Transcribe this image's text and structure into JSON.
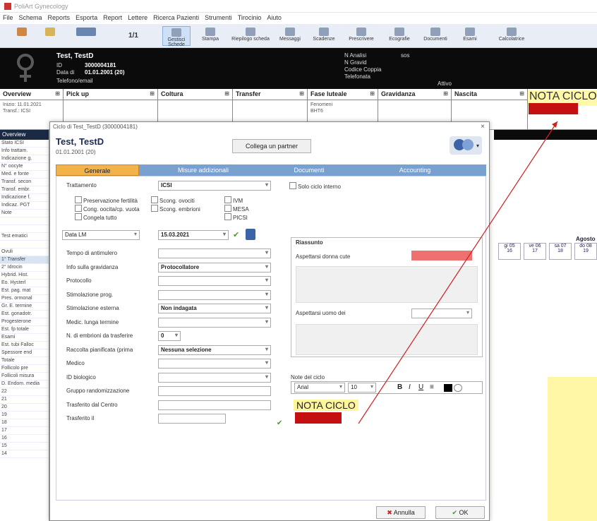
{
  "window": {
    "title": "PoliArt Gynecology",
    "app_icon": "app-logo-icon"
  },
  "menu": [
    "File",
    "Schema",
    "Reports",
    "Esporta",
    "Report",
    "Lettere",
    "Ricerca Pazienti",
    "Strumenti",
    "Tirocinio",
    "Aiuto"
  ],
  "toolbar": {
    "page_indicator": "1/1",
    "items": [
      {
        "label": "Gestisci Schede",
        "icon": "folder-icon"
      },
      {
        "label": "Stampa",
        "icon": "printer-icon"
      },
      {
        "label": "Riepilogo scheda",
        "icon": "summary-icon"
      },
      {
        "label": "Messaggi",
        "icon": "message-icon"
      },
      {
        "label": "Scadenze",
        "icon": "calendar-icon"
      },
      {
        "label": "Prescrivere",
        "icon": "prescription-icon"
      },
      {
        "label": "Ecografie",
        "icon": "ultrasound-icon"
      },
      {
        "label": "Documenti",
        "icon": "document-icon"
      },
      {
        "label": "Esami",
        "icon": "exam-icon"
      },
      {
        "label": "Calcolatrice",
        "icon": "calculator-icon"
      }
    ]
  },
  "patient": {
    "name": "Test, TestD",
    "id_label": "ID",
    "id_value": "3000004181",
    "dob_label": "Data di",
    "dob_value": "01.01.2001 (20)",
    "extra_label": "Telefono/email",
    "right_labels": [
      "N Analisi",
      "N Gravid",
      "Codice Coppia",
      "Telefonata"
    ],
    "right_value": "sos",
    "status": "Attivo"
  },
  "columns": [
    {
      "title": "Overview",
      "content": [
        "Inizio: 11.01.2021",
        "Transf.: ICSI"
      ]
    },
    {
      "title": "Pick up",
      "content": []
    },
    {
      "title": "Coltura",
      "content": []
    },
    {
      "title": "Transfer",
      "content": []
    },
    {
      "title": "Fase luteale",
      "content": [
        "Fenomeni",
        "BHT6"
      ]
    },
    {
      "title": "Gravidanza",
      "content": []
    },
    {
      "title": "Nascita",
      "content": []
    }
  ],
  "nota_header": "NOTA CICLO",
  "left_panel": {
    "tab": "Overview",
    "rows": [
      "Stato ICSI",
      "Info trattam.",
      "Indicazione g.",
      "N° oocyte",
      "Med. e fonte",
      "Transf. secon",
      "Transf. embr.",
      "Indicazione f.",
      "Indicaz. PGT",
      "Note",
      "",
      "",
      "Test ematici",
      "",
      "Ovuli",
      "1° Transfer",
      "2° Idrocin",
      "Hybrid. Hist.",
      "Eo. Hysterl",
      "Est. pag. mat",
      "Pres. ormonal",
      "Gr. E. termine",
      "Est. gonadotr.",
      "Progesterone",
      "Est. fp totale",
      "Esami",
      "Est. tubi Falloc",
      "Spessore end",
      "Totale",
      "Follicolo pre",
      "Follicoli misura",
      "D. Endom. media",
      "22",
      "21",
      "20",
      "19",
      "18",
      "17",
      "16",
      "15",
      "14"
    ],
    "highlight_index": 15
  },
  "calendar": {
    "header": "Agosto",
    "cells": [
      {
        "day": "gi 05",
        "num": "16"
      },
      {
        "day": "ve 06",
        "num": "17"
      },
      {
        "day": "sa 07",
        "num": "18"
      },
      {
        "day": "do 08",
        "num": "19"
      }
    ]
  },
  "dialog": {
    "title": "Ciclo di Test_TestD (3000004181)",
    "close_label": "×",
    "name": "Test, TestD",
    "dob": "01.01.2001 (20)",
    "collega_button": "Collega un partner",
    "tabs": [
      "Generale",
      "Misure addizionali",
      "Documenti",
      "Accounting"
    ],
    "active_tab": 0,
    "form": {
      "trattamento_label": "Trattamento",
      "trattamento_value": "ICSI",
      "solo_test_label": "Solo ciclo interno",
      "checkboxes_left": [
        "Preservazione fertilità",
        "Cong. oocita/cp. vuota",
        "Congela tutto"
      ],
      "checkboxes_mid": [
        "Scong. ovociti",
        "Scong. embrioni"
      ],
      "checkboxes_right": [
        "IVM",
        "MESA",
        "PICSI"
      ],
      "date_type": "Data LM",
      "date_value": "15.03.2021",
      "fields": [
        {
          "label": "Tempo di antimulero",
          "value": ""
        },
        {
          "label": "Info sulla gravidanza",
          "value": "Protocollatore"
        },
        {
          "label": "Protocollo",
          "value": ""
        },
        {
          "label": "Stimolazione prog.",
          "value": ""
        },
        {
          "label": "Stimolazione esterna",
          "value": "Non indagata"
        },
        {
          "label": "Medic. lunga termine",
          "value": ""
        },
        {
          "label": "N. di embrioni da trasferire",
          "value": "0"
        },
        {
          "label": "Raccolta pianificata (prima",
          "value": "Nessuna selezione"
        },
        {
          "label": "Medico",
          "value": ""
        },
        {
          "label": "ID biologico",
          "value": ""
        },
        {
          "label": "Gruppo randomizzazione",
          "value": ""
        },
        {
          "label": "Trasferito dal Centro",
          "value": ""
        },
        {
          "label": "Trasferito il",
          "value": ""
        }
      ]
    },
    "riassunto": {
      "title": "Riassunto",
      "row1_label": "Aspettarsi donna cute",
      "row2_label": "Aspettarsi uomo dei"
    },
    "notes": {
      "title": "Note del ciclo",
      "font": "Arial",
      "size": "10",
      "text": "NOTA CICLO",
      "highlight_color": "#c41010"
    },
    "annulla_button": "Annulla",
    "ok_button": "OK"
  }
}
